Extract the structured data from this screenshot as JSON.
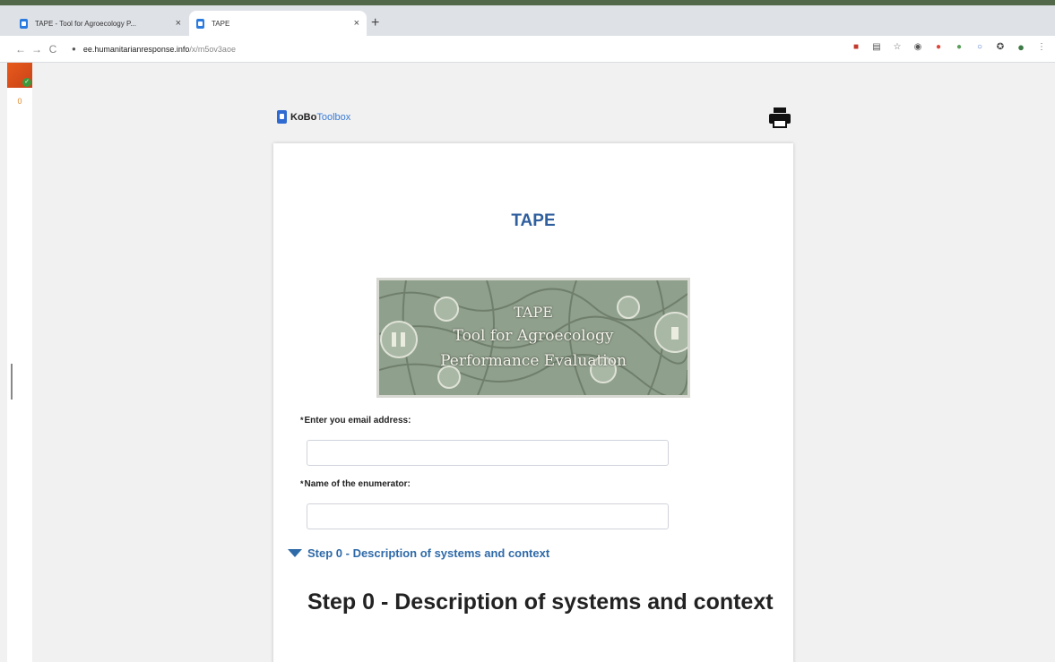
{
  "browser": {
    "tabs": [
      {
        "title": "TAPE - Tool for Agroecology P...",
        "active": false
      },
      {
        "title": "TAPE",
        "active": true
      }
    ],
    "close_glyph": "×",
    "new_tab_glyph": "+",
    "nav": {
      "back": "←",
      "forward": "→",
      "reload": "C"
    },
    "url": {
      "host": "ee.humanitarianresponse.info",
      "path": "/x/m5ov3aoe"
    },
    "extensions": [
      "translate-icon",
      "reader-icon",
      "star-icon",
      "puzzle-icon",
      "extension-red-icon",
      "extension-green-icon",
      "extension-circle-icon",
      "extensions-icon",
      "profile-avatar-icon",
      "menu-icon"
    ]
  },
  "sidebar": {
    "badge_count": "0"
  },
  "header": {
    "logo_kobo": "KoBo",
    "logo_toolbox": "Toolbox"
  },
  "form": {
    "title": "TAPE",
    "banner": {
      "line1": "TAPE",
      "line2": "Tool for Agroecology",
      "line3": "Performance Evaluation"
    },
    "questions": [
      {
        "required": "*",
        "label": "Enter you email address:",
        "value": ""
      },
      {
        "required": "*",
        "label": "Name of the enumerator:",
        "value": ""
      }
    ],
    "group": {
      "toggle_label": "Step 0 - Description of systems and context",
      "heading": "Step 0 - Description of systems and context"
    }
  },
  "colors": {
    "accent": "#2f6aa8",
    "title": "#2f5f9e",
    "desktop": "#536849"
  }
}
